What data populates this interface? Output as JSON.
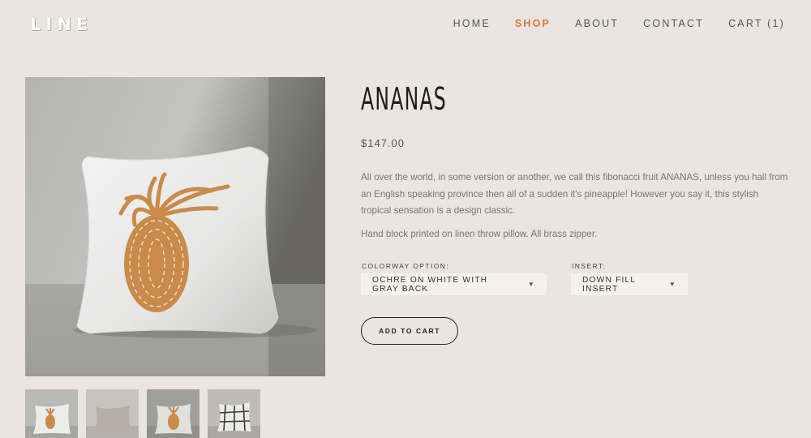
{
  "header": {
    "logo": "LINE",
    "nav": [
      "HOME",
      "SHOP",
      "ABOUT",
      "CONTACT",
      "CART (1)"
    ],
    "active_nav": "SHOP"
  },
  "colors": {
    "accent": "#d9772f",
    "background": "#ebe4e3"
  },
  "product": {
    "title": "ANANAS",
    "price": "$147.00",
    "description": "All over the world, in some version or another, we call this fibonacci fruit ANANAS, unless you hail from an English speaking province then all of a sudden it's pineapple! However you say it, this stylish tropical sensation is a design classic.",
    "details": "Hand block printed on linen throw pillow. All brass zipper.",
    "colorway_label": "COLORWAY OPTION:",
    "colorway_value": "OCHRE ON WHITE WITH GRAY BACK",
    "insert_label": "INSERT:",
    "insert_value": "DOWN FILL INSERT",
    "add_to_cart": "ADD TO CART"
  },
  "images": {
    "main": "pineapple-pillow-photo",
    "thumbnails": [
      "pineapple-pillow-thumb",
      "plain-linen-pillow-thumb",
      "pineapple-pillow-angle-thumb",
      "plaid-pillow-thumb"
    ]
  }
}
